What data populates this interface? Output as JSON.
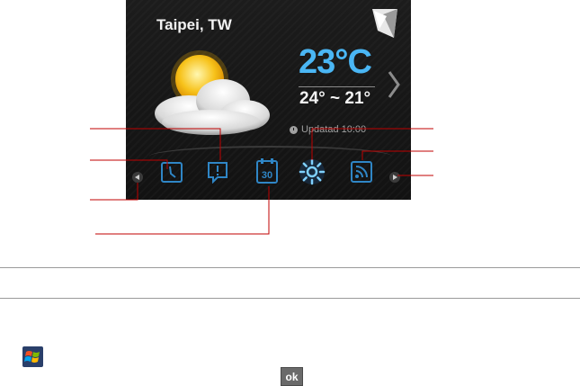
{
  "widget": {
    "city": "Taipei, TW",
    "temperature": "23°C",
    "range": "24° ~ 21°",
    "updated": "Updatad 10:00",
    "calendar_day": "30",
    "weather_condition": "partly-cloudy",
    "accent_color": "#4ab6f4",
    "tabs": [
      {
        "name": "clock-tab",
        "icon": "clock-icon"
      },
      {
        "name": "messages-tab",
        "icon": "message-alert-icon"
      },
      {
        "name": "calendar-tab",
        "icon": "calendar-icon"
      },
      {
        "name": "weather-tab",
        "icon": "sun-icon",
        "selected": true
      },
      {
        "name": "rss-tab",
        "icon": "rss-icon"
      }
    ]
  },
  "callout_color": "#c00000",
  "footer": {
    "ok_label": "ok",
    "start_icon": "windows-flag-icon"
  }
}
